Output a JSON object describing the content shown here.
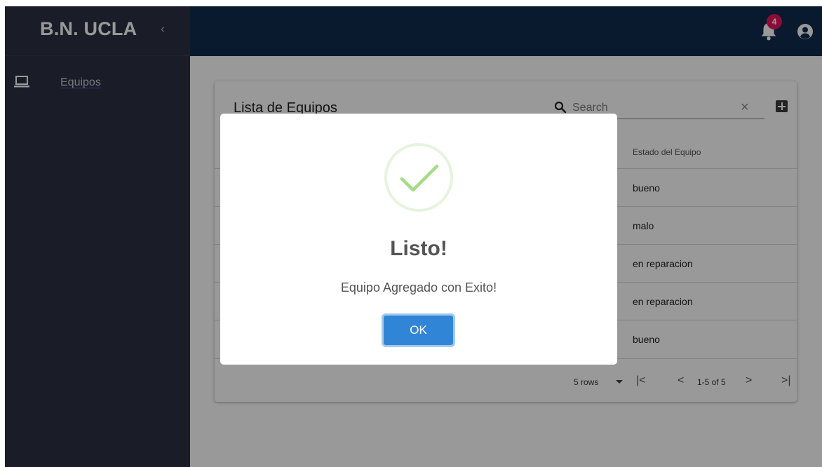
{
  "sidebar": {
    "brand": "B.N. UCLA",
    "collapse_icon": "‹",
    "items": [
      {
        "label": "Equipos",
        "icon": "laptop-icon"
      }
    ]
  },
  "topbar": {
    "notification_count": "4",
    "icons": [
      "bell-icon",
      "user-icon"
    ]
  },
  "card": {
    "title": "Lista de Equipos",
    "search": {
      "placeholder": "Search",
      "value": ""
    },
    "clear_icon": "×",
    "column_header": "Estado del Equipo",
    "rows": [
      "bueno",
      "malo",
      "en reparacion",
      "en reparacion",
      "bueno"
    ],
    "pagination": {
      "rows_per_page": "5 rows",
      "first": "|<",
      "prev": "<",
      "info": "1-5 of 5",
      "next": ">",
      "last": ">|"
    }
  },
  "modal": {
    "title": "Listo!",
    "message": "Equipo Agregado con Exito!",
    "ok_label": "OK",
    "icon": "success-check-icon"
  },
  "colors": {
    "sidebar_bg": "#2c3143",
    "topbar_bg": "#0f2b4d",
    "badge": "#e8175d",
    "ok_button": "#3085d6",
    "success_check": "#a5dc86"
  }
}
